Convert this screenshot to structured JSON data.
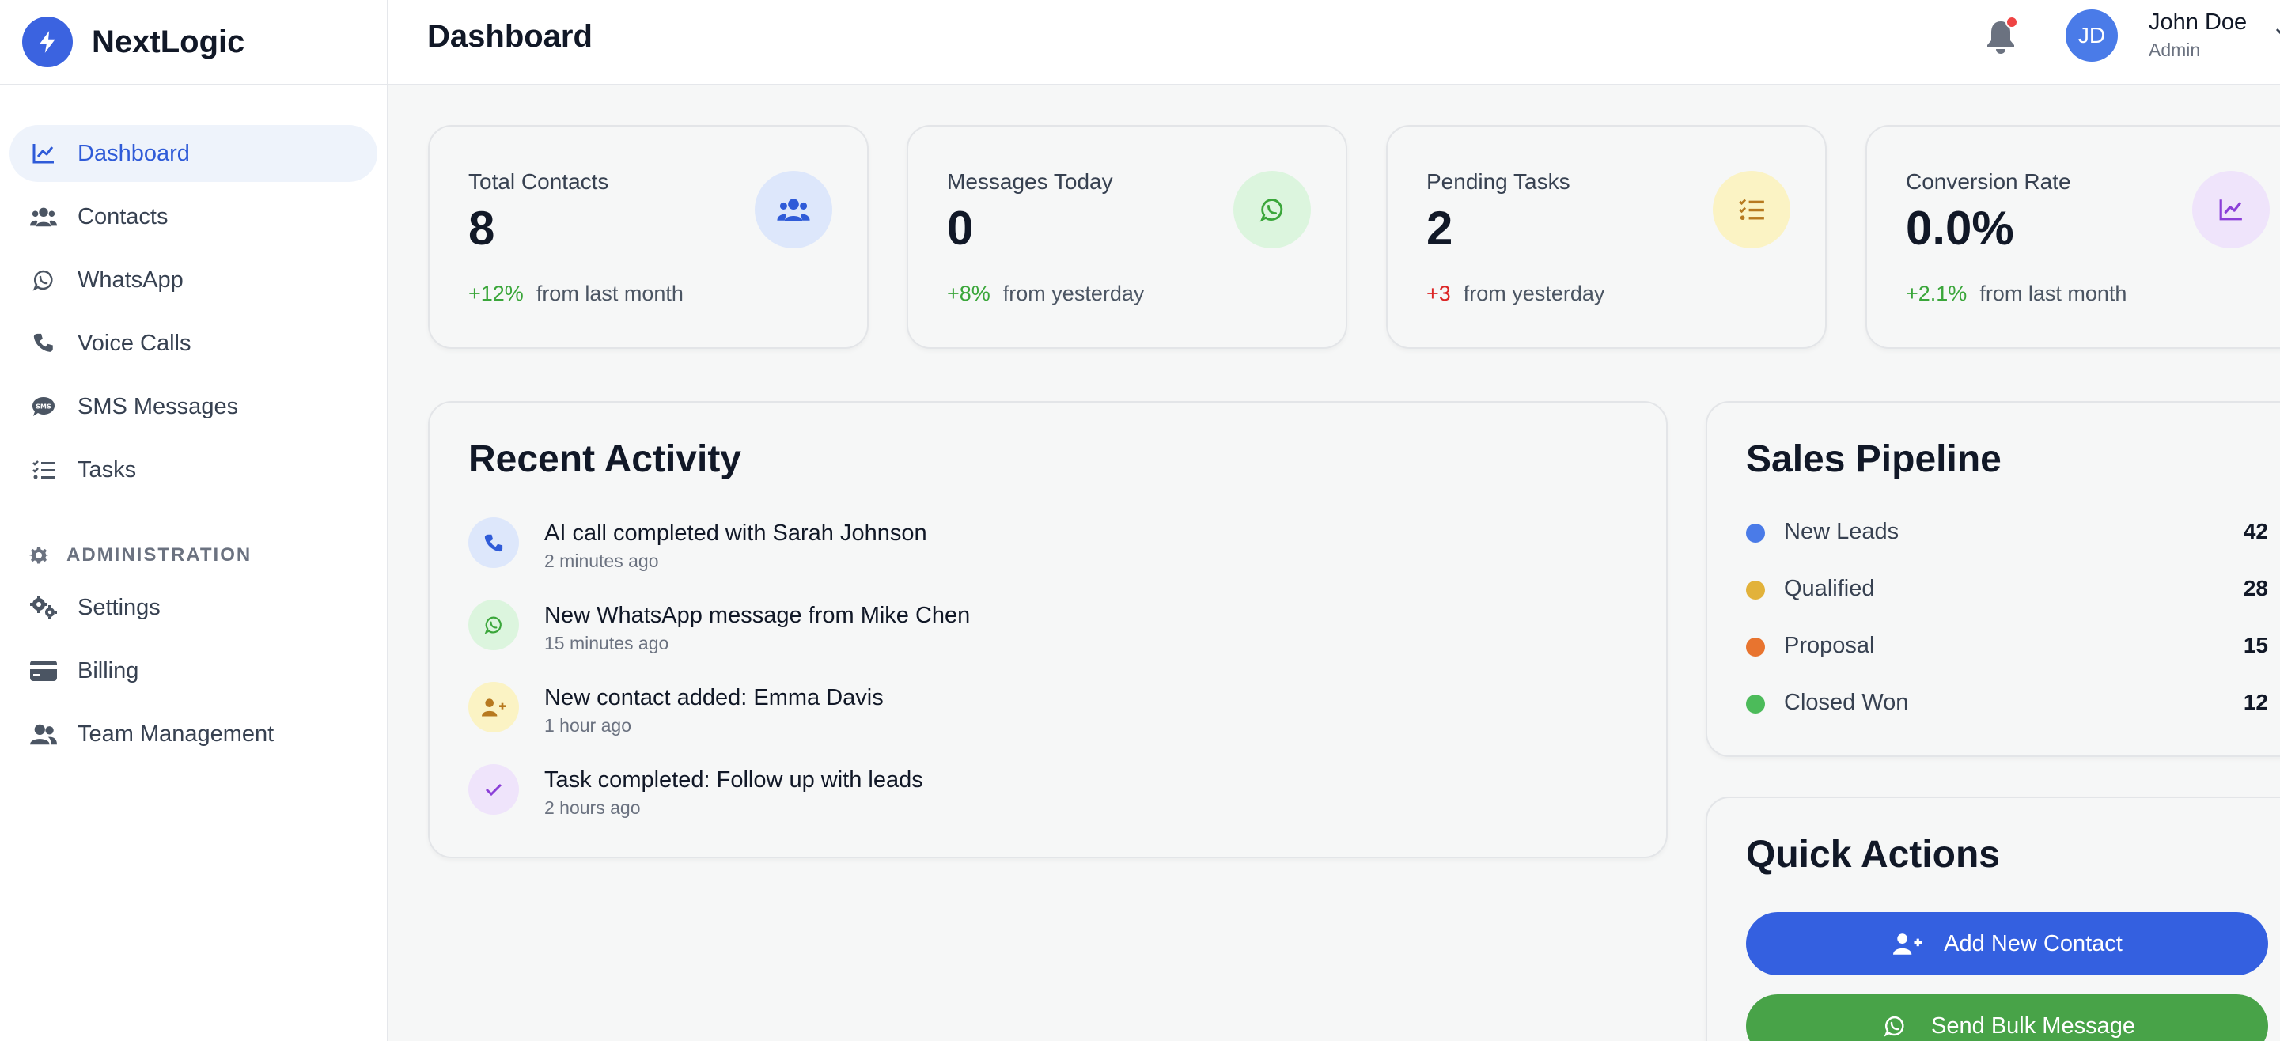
{
  "brand": {
    "name": "NextLogic",
    "icon": "bolt-icon"
  },
  "header": {
    "title": "Dashboard",
    "user": {
      "initials": "JD",
      "name": "John Doe",
      "role": "Admin"
    }
  },
  "sidebar": {
    "items": [
      {
        "label": "Dashboard",
        "icon": "chart-line-icon",
        "active": true
      },
      {
        "label": "Contacts",
        "icon": "users-icon"
      },
      {
        "label": "WhatsApp",
        "icon": "whatsapp-icon"
      },
      {
        "label": "Voice Calls",
        "icon": "phone-icon"
      },
      {
        "label": "SMS Messages",
        "icon": "sms-icon"
      },
      {
        "label": "Tasks",
        "icon": "tasks-icon"
      }
    ],
    "admin_section": "ADMINISTRATION",
    "admin_items": [
      {
        "label": "Settings",
        "icon": "gears-icon"
      },
      {
        "label": "Billing",
        "icon": "credit-card-icon"
      },
      {
        "label": "Team Management",
        "icon": "team-icon"
      }
    ]
  },
  "stats": [
    {
      "label": "Total Contacts",
      "value": "8",
      "delta": "+12%",
      "suffix": "from last month",
      "delta_color": "#3aa63a",
      "icon": "users-icon",
      "icon_bg": "#dde7fb",
      "icon_color": "#2f5bd8"
    },
    {
      "label": "Messages Today",
      "value": "0",
      "delta": "+8%",
      "suffix": "from yesterday",
      "delta_color": "#3aa63a",
      "icon": "whatsapp-icon",
      "icon_bg": "#dcf5de",
      "icon_color": "#3aa63a"
    },
    {
      "label": "Pending Tasks",
      "value": "2",
      "delta": "+3",
      "suffix": "from yesterday",
      "delta_color": "#dc2626",
      "icon": "tasks-icon",
      "icon_bg": "#fbf3c4",
      "icon_color": "#b7791f"
    },
    {
      "label": "Conversion Rate",
      "value": "0.0%",
      "delta": "+2.1%",
      "suffix": "from last month",
      "delta_color": "#3aa63a",
      "icon": "chart-line-icon",
      "icon_bg": "#efe4fb",
      "icon_color": "#8b3fd8"
    }
  ],
  "activity": {
    "title": "Recent Activity",
    "items": [
      {
        "title": "AI call completed with Sarah Johnson",
        "time": "2 minutes ago",
        "icon": "phone-icon",
        "bg": "#dde7fb",
        "color": "#2f5bd8"
      },
      {
        "title": "New WhatsApp message from Mike Chen",
        "time": "15 minutes ago",
        "icon": "whatsapp-icon",
        "bg": "#dcf5de",
        "color": "#3aa63a"
      },
      {
        "title": "New contact added: Emma Davis",
        "time": "1 hour ago",
        "icon": "user-plus-icon",
        "bg": "#fbf3c4",
        "color": "#b7791f"
      },
      {
        "title": "Task completed: Follow up with leads",
        "time": "2 hours ago",
        "icon": "check-icon",
        "bg": "#efe4fb",
        "color": "#8b3fd8"
      }
    ]
  },
  "pipeline": {
    "title": "Sales Pipeline",
    "items": [
      {
        "label": "New Leads",
        "count": "42",
        "color": "#4a7be8"
      },
      {
        "label": "Qualified",
        "count": "28",
        "color": "#e2b23a"
      },
      {
        "label": "Proposal",
        "count": "15",
        "color": "#e8742f"
      },
      {
        "label": "Closed Won",
        "count": "12",
        "color": "#4cbb5a"
      }
    ]
  },
  "quick_actions": {
    "title": "Quick Actions",
    "buttons": [
      {
        "label": "Add New Contact",
        "icon": "user-plus-icon",
        "color": "#3460e0"
      },
      {
        "label": "Send Bulk Message",
        "icon": "whatsapp-icon",
        "color": "#48a348"
      }
    ]
  }
}
